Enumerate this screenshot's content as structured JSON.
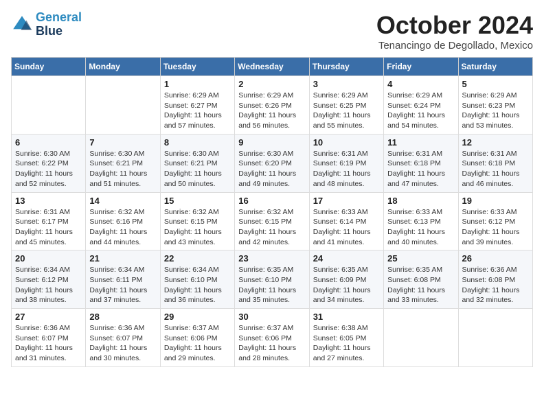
{
  "logo": {
    "line1": "General",
    "line2": "Blue"
  },
  "title": "October 2024",
  "location": "Tenancingo de Degollado, Mexico",
  "weekdays": [
    "Sunday",
    "Monday",
    "Tuesday",
    "Wednesday",
    "Thursday",
    "Friday",
    "Saturday"
  ],
  "weeks": [
    [
      null,
      null,
      {
        "day": "1",
        "sunrise": "6:29 AM",
        "sunset": "6:27 PM",
        "daylight": "11 hours and 57 minutes."
      },
      {
        "day": "2",
        "sunrise": "6:29 AM",
        "sunset": "6:26 PM",
        "daylight": "11 hours and 56 minutes."
      },
      {
        "day": "3",
        "sunrise": "6:29 AM",
        "sunset": "6:25 PM",
        "daylight": "11 hours and 55 minutes."
      },
      {
        "day": "4",
        "sunrise": "6:29 AM",
        "sunset": "6:24 PM",
        "daylight": "11 hours and 54 minutes."
      },
      {
        "day": "5",
        "sunrise": "6:29 AM",
        "sunset": "6:23 PM",
        "daylight": "11 hours and 53 minutes."
      }
    ],
    [
      {
        "day": "6",
        "sunrise": "6:30 AM",
        "sunset": "6:22 PM",
        "daylight": "11 hours and 52 minutes."
      },
      {
        "day": "7",
        "sunrise": "6:30 AM",
        "sunset": "6:21 PM",
        "daylight": "11 hours and 51 minutes."
      },
      {
        "day": "8",
        "sunrise": "6:30 AM",
        "sunset": "6:21 PM",
        "daylight": "11 hours and 50 minutes."
      },
      {
        "day": "9",
        "sunrise": "6:30 AM",
        "sunset": "6:20 PM",
        "daylight": "11 hours and 49 minutes."
      },
      {
        "day": "10",
        "sunrise": "6:31 AM",
        "sunset": "6:19 PM",
        "daylight": "11 hours and 48 minutes."
      },
      {
        "day": "11",
        "sunrise": "6:31 AM",
        "sunset": "6:18 PM",
        "daylight": "11 hours and 47 minutes."
      },
      {
        "day": "12",
        "sunrise": "6:31 AM",
        "sunset": "6:18 PM",
        "daylight": "11 hours and 46 minutes."
      }
    ],
    [
      {
        "day": "13",
        "sunrise": "6:31 AM",
        "sunset": "6:17 PM",
        "daylight": "11 hours and 45 minutes."
      },
      {
        "day": "14",
        "sunrise": "6:32 AM",
        "sunset": "6:16 PM",
        "daylight": "11 hours and 44 minutes."
      },
      {
        "day": "15",
        "sunrise": "6:32 AM",
        "sunset": "6:15 PM",
        "daylight": "11 hours and 43 minutes."
      },
      {
        "day": "16",
        "sunrise": "6:32 AM",
        "sunset": "6:15 PM",
        "daylight": "11 hours and 42 minutes."
      },
      {
        "day": "17",
        "sunrise": "6:33 AM",
        "sunset": "6:14 PM",
        "daylight": "11 hours and 41 minutes."
      },
      {
        "day": "18",
        "sunrise": "6:33 AM",
        "sunset": "6:13 PM",
        "daylight": "11 hours and 40 minutes."
      },
      {
        "day": "19",
        "sunrise": "6:33 AM",
        "sunset": "6:12 PM",
        "daylight": "11 hours and 39 minutes."
      }
    ],
    [
      {
        "day": "20",
        "sunrise": "6:34 AM",
        "sunset": "6:12 PM",
        "daylight": "11 hours and 38 minutes."
      },
      {
        "day": "21",
        "sunrise": "6:34 AM",
        "sunset": "6:11 PM",
        "daylight": "11 hours and 37 minutes."
      },
      {
        "day": "22",
        "sunrise": "6:34 AM",
        "sunset": "6:10 PM",
        "daylight": "11 hours and 36 minutes."
      },
      {
        "day": "23",
        "sunrise": "6:35 AM",
        "sunset": "6:10 PM",
        "daylight": "11 hours and 35 minutes."
      },
      {
        "day": "24",
        "sunrise": "6:35 AM",
        "sunset": "6:09 PM",
        "daylight": "11 hours and 34 minutes."
      },
      {
        "day": "25",
        "sunrise": "6:35 AM",
        "sunset": "6:08 PM",
        "daylight": "11 hours and 33 minutes."
      },
      {
        "day": "26",
        "sunrise": "6:36 AM",
        "sunset": "6:08 PM",
        "daylight": "11 hours and 32 minutes."
      }
    ],
    [
      {
        "day": "27",
        "sunrise": "6:36 AM",
        "sunset": "6:07 PM",
        "daylight": "11 hours and 31 minutes."
      },
      {
        "day": "28",
        "sunrise": "6:36 AM",
        "sunset": "6:07 PM",
        "daylight": "11 hours and 30 minutes."
      },
      {
        "day": "29",
        "sunrise": "6:37 AM",
        "sunset": "6:06 PM",
        "daylight": "11 hours and 29 minutes."
      },
      {
        "day": "30",
        "sunrise": "6:37 AM",
        "sunset": "6:06 PM",
        "daylight": "11 hours and 28 minutes."
      },
      {
        "day": "31",
        "sunrise": "6:38 AM",
        "sunset": "6:05 PM",
        "daylight": "11 hours and 27 minutes."
      },
      null,
      null
    ]
  ]
}
